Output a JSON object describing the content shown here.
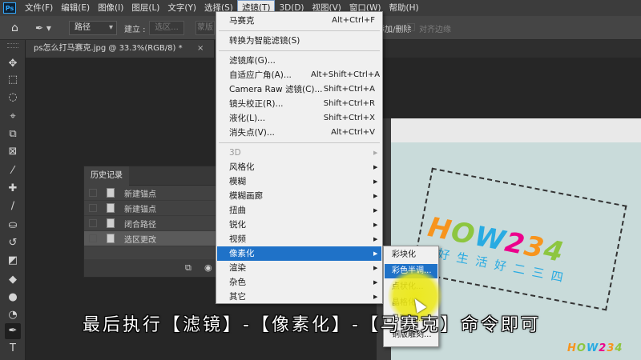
{
  "menubar": {
    "app_icon": "Ps",
    "items": [
      "文件(F)",
      "编辑(E)",
      "图像(I)",
      "图层(L)",
      "文字(Y)",
      "选择(S)",
      "滤镜(T)",
      "3D(D)",
      "视图(V)",
      "窗口(W)",
      "帮助(H)"
    ],
    "active_index": 6
  },
  "options_bar": {
    "mode_value": "路径",
    "build_label": "建立 :",
    "selection_btn": "选区...",
    "mask_btn": "蒙版",
    "add_delete": "添加/删除",
    "align_edges": "对齐边缘"
  },
  "document_tab": {
    "title": "ps怎么打马赛克.jpg @ 33.3%(RGB/8) *",
    "close": "×"
  },
  "toolbar": {
    "icons": [
      "move-icon",
      "marquee-icon",
      "lasso-icon",
      "quick-select-icon",
      "crop-icon",
      "frame-icon",
      "eyedropper-icon",
      "healing-icon",
      "brush-icon",
      "stamp-icon",
      "history-brush-icon",
      "eraser-icon",
      "bucket-icon",
      "blur-icon",
      "dodge-icon",
      "pen-icon",
      "type-icon"
    ],
    "glyphs": [
      "✥",
      "⬚",
      "◌",
      "⌖",
      "⧉",
      "⊠",
      "⁄",
      "✚",
      "∕",
      "⛀",
      "↺",
      "◩",
      "◆",
      "●",
      "◔",
      "✒",
      "T"
    ],
    "selected_index": 15
  },
  "history_panel": {
    "tab_label": "历史记录",
    "rows": [
      "新建锚点",
      "新建锚点",
      "闭合路径",
      "选区更改"
    ],
    "selected_index": 3
  },
  "filter_menu": {
    "items": [
      {
        "label": "马赛克",
        "shortcut": "Alt+Ctrl+F",
        "arrow": false,
        "disabled": false
      },
      {
        "sep": true
      },
      {
        "label": "转换为智能滤镜(S)",
        "shortcut": "",
        "arrow": false,
        "disabled": false
      },
      {
        "sep": true
      },
      {
        "label": "滤镜库(G)...",
        "shortcut": "",
        "arrow": false,
        "disabled": false
      },
      {
        "label": "自适应广角(A)...",
        "shortcut": "Alt+Shift+Ctrl+A",
        "arrow": false,
        "disabled": false
      },
      {
        "label": "Camera Raw 滤镜(C)...",
        "shortcut": "Shift+Ctrl+A",
        "arrow": false,
        "disabled": false
      },
      {
        "label": "镜头校正(R)...",
        "shortcut": "Shift+Ctrl+R",
        "arrow": false,
        "disabled": false
      },
      {
        "label": "液化(L)...",
        "shortcut": "Shift+Ctrl+X",
        "arrow": false,
        "disabled": false
      },
      {
        "label": "消失点(V)...",
        "shortcut": "Alt+Ctrl+V",
        "arrow": false,
        "disabled": false
      },
      {
        "sep": true
      },
      {
        "label": "3D",
        "shortcut": "",
        "arrow": true,
        "disabled": true
      },
      {
        "label": "风格化",
        "shortcut": "",
        "arrow": true,
        "disabled": false
      },
      {
        "label": "模糊",
        "shortcut": "",
        "arrow": true,
        "disabled": false
      },
      {
        "label": "模糊画廊",
        "shortcut": "",
        "arrow": true,
        "disabled": false
      },
      {
        "label": "扭曲",
        "shortcut": "",
        "arrow": true,
        "disabled": false
      },
      {
        "label": "锐化",
        "shortcut": "",
        "arrow": true,
        "disabled": false
      },
      {
        "label": "视频",
        "shortcut": "",
        "arrow": true,
        "disabled": false
      },
      {
        "label": "像素化",
        "shortcut": "",
        "arrow": true,
        "disabled": false,
        "highlighted": true
      },
      {
        "label": "渲染",
        "shortcut": "",
        "arrow": true,
        "disabled": false
      },
      {
        "label": "杂色",
        "shortcut": "",
        "arrow": true,
        "disabled": false
      },
      {
        "label": "其它",
        "shortcut": "",
        "arrow": true,
        "disabled": false
      }
    ]
  },
  "pixelate_submenu": {
    "items": [
      "彩块化",
      "彩色半调...",
      "点状化...",
      "晶格化...",
      "马赛克...",
      "铜版雕刻..."
    ],
    "highlighted_index": 1
  },
  "canvas": {
    "logo_text": "HOW234",
    "logo_chars": [
      "H",
      "O",
      "W",
      "2",
      "3",
      "4"
    ],
    "slogan": "好生活好二三四"
  },
  "subtitle": "最后执行【滤镜】-【像素化】-【马赛克】命令即可"
}
